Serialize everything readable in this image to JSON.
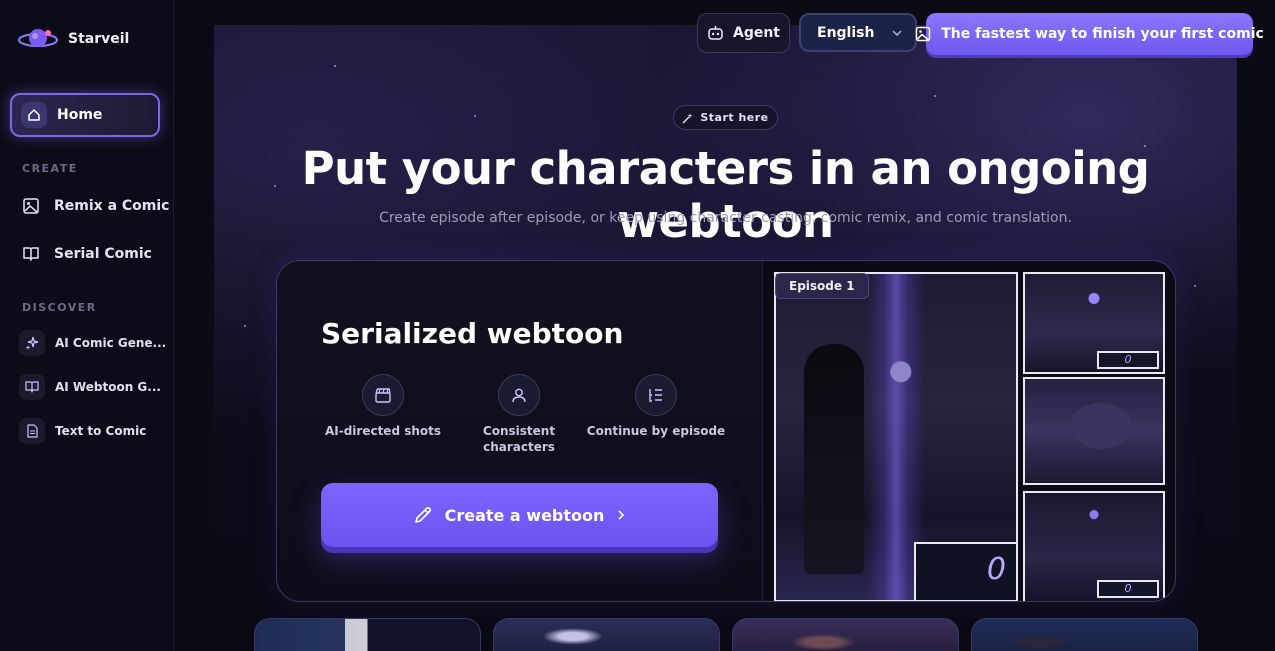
{
  "brand": {
    "name": "Starveil"
  },
  "sidebar": {
    "home": {
      "label": "Home",
      "icon": "home-icon"
    },
    "create_label": "CREATE",
    "create_items": [
      {
        "label": "Remix a Comic",
        "icon": "image-icon"
      },
      {
        "label": "Serial Comic",
        "icon": "book-icon"
      }
    ],
    "discover_label": "DISCOVER",
    "discover_items": [
      {
        "label": "AI Comic Gene...",
        "icon": "sparkles-icon"
      },
      {
        "label": "AI Webtoon G...",
        "icon": "book-icon"
      },
      {
        "label": "Text to Comic",
        "icon": "document-icon"
      }
    ]
  },
  "topbar": {
    "agent_label": "Agent",
    "language": "English",
    "cta_label": "The fastest way to finish your first comic"
  },
  "hero": {
    "pill": "Start here",
    "title": "Put your characters in an ongoing webtoon",
    "subtitle": "Create episode after episode, or keep using character casting, comic remix, and comic translation."
  },
  "card": {
    "title": "Serialized webtoon",
    "features": [
      {
        "label": "AI-directed shots",
        "icon": "clapperboard-icon"
      },
      {
        "label": "Consistent characters",
        "icon": "user-icon"
      },
      {
        "label": "Continue by episode",
        "icon": "list-icon"
      }
    ],
    "button_label": "Create a webtoon",
    "episode_tag": "Episode 1",
    "panel_text_big": "0",
    "panel_text_small_1": "0",
    "panel_text_small_2": "0"
  },
  "colors": {
    "accent": "#7b64f8",
    "background": "#0b0b16",
    "sidebar": "#0c0c18"
  }
}
